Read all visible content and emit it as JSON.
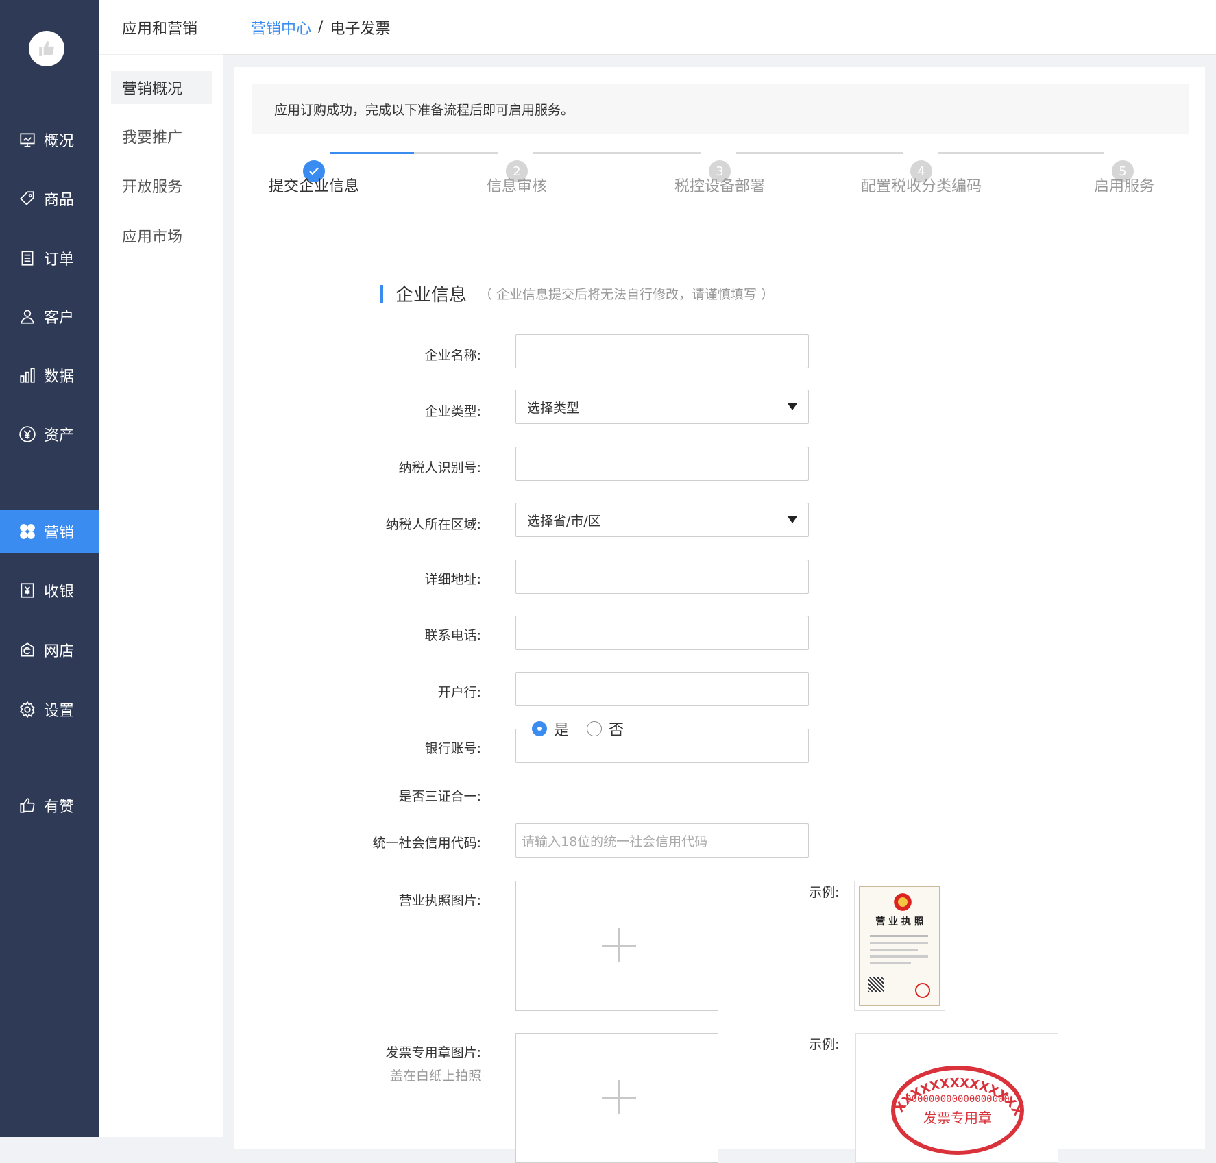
{
  "sidebar": {
    "items": [
      {
        "label": "概况",
        "icon": "presentation-icon"
      },
      {
        "label": "商品",
        "icon": "tag-icon"
      },
      {
        "label": "订单",
        "icon": "document-icon"
      },
      {
        "label": "客户",
        "icon": "user-icon"
      },
      {
        "label": "数据",
        "icon": "bar-chart-icon"
      },
      {
        "label": "资产",
        "icon": "yen-circle-icon"
      },
      {
        "label": "营销",
        "icon": "clover-icon",
        "active": true
      },
      {
        "label": "收银",
        "icon": "receipt-icon"
      },
      {
        "label": "网店",
        "icon": "shop-icon"
      },
      {
        "label": "设置",
        "icon": "gear-icon"
      },
      {
        "label": "有赞",
        "icon": "thumbs-up-icon"
      }
    ],
    "accent": "#3b8cf0",
    "bg": "#2f3a56"
  },
  "second_nav": {
    "title": "应用和营销",
    "items": [
      "营销概况",
      "我要推广",
      "开放服务",
      "应用市场"
    ],
    "active_index": 0
  },
  "breadcrumb": {
    "link": "营销中心",
    "sep": "/",
    "current": "电子发票"
  },
  "notice": "应用订购成功，完成以下准备流程后即可启用服务。",
  "steps": [
    {
      "num": "✓",
      "label": "提交企业信息",
      "done": true
    },
    {
      "num": "2",
      "label": "信息审核"
    },
    {
      "num": "3",
      "label": "税控设备部署"
    },
    {
      "num": "4",
      "label": "配置税收分类编码"
    },
    {
      "num": "5",
      "label": "启用服务"
    }
  ],
  "step_progress": 0.5,
  "section": {
    "title": "企业信息",
    "hint": "（ 企业信息提交后将无法自行修改，请谨慎填写 ）"
  },
  "form": {
    "company_name": {
      "label": "企业名称:",
      "value": ""
    },
    "company_type": {
      "label": "企业类型:",
      "value": "选择类型"
    },
    "taxpayer_id": {
      "label": "纳税人识别号:",
      "value": ""
    },
    "taxpayer_region": {
      "label": "纳税人所在区域:",
      "value": "选择省/市/区"
    },
    "address": {
      "label": "详细地址:",
      "value": ""
    },
    "phone": {
      "label": "联系电话:",
      "value": ""
    },
    "bank": {
      "label": "开户行:",
      "value": ""
    },
    "bank_account": {
      "label": "银行账号:",
      "value": ""
    },
    "three_in_one": {
      "label": "是否三证合一:",
      "options": [
        "是",
        "否"
      ],
      "selected": "是"
    },
    "credit_code": {
      "label": "统一社会信用代码:",
      "placeholder": "请输入18位的统一社会信用代码"
    },
    "license_image": {
      "label": "营业执照图片:"
    },
    "stamp_image": {
      "label": "发票专用章图片:",
      "sub": "盖在白纸上拍照"
    }
  },
  "examples": {
    "label": "示例:",
    "license_title": "营 业 执 照",
    "stamp_text_top": "XXXXXXXXXXXXXXXXX",
    "stamp_number": "000000000000000000",
    "stamp_name": "发票专用章"
  }
}
